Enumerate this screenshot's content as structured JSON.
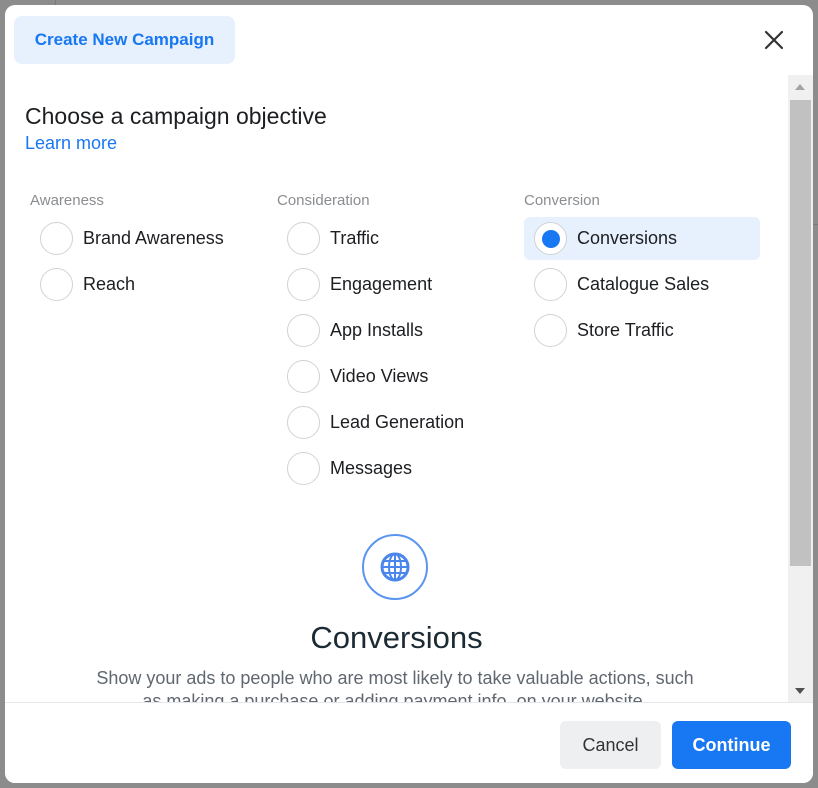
{
  "dialog": {
    "header_title": "Create New Campaign",
    "close_icon": "close-icon",
    "heading": "Choose a campaign objective",
    "learn_more": "Learn more"
  },
  "columns": [
    {
      "label": "Awareness",
      "options": [
        {
          "label": "Brand Awareness",
          "selected": false
        },
        {
          "label": "Reach",
          "selected": false
        }
      ]
    },
    {
      "label": "Consideration",
      "options": [
        {
          "label": "Traffic",
          "selected": false
        },
        {
          "label": "Engagement",
          "selected": false
        },
        {
          "label": "App Installs",
          "selected": false
        },
        {
          "label": "Video Views",
          "selected": false
        },
        {
          "label": "Lead Generation",
          "selected": false
        },
        {
          "label": "Messages",
          "selected": false
        }
      ]
    },
    {
      "label": "Conversion",
      "options": [
        {
          "label": "Conversions",
          "selected": true
        },
        {
          "label": "Catalogue Sales",
          "selected": false
        },
        {
          "label": "Store Traffic",
          "selected": false
        }
      ]
    }
  ],
  "detail": {
    "icon": "globe-icon",
    "title": "Conversions",
    "description": "Show your ads to people who are most likely to take valuable actions, such as making a purchase or adding payment info, on your website."
  },
  "footer": {
    "cancel_label": "Cancel",
    "continue_label": "Continue"
  },
  "colors": {
    "accent": "#1877f2",
    "selected_bg": "#e7f0fd"
  }
}
